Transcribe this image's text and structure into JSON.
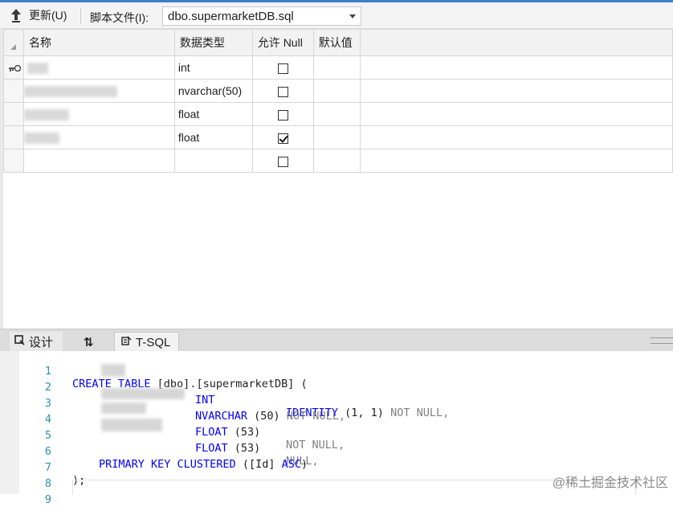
{
  "toolbar": {
    "update_label": "更新(U)",
    "script_file_label": "脚本文件(I):",
    "script_file_value": "dbo.supermarketDB.sql"
  },
  "grid": {
    "headers": [
      "名称",
      "数据类型",
      "允许 Null",
      "默认值"
    ],
    "rows": [
      {
        "type": "int",
        "allow_null": false,
        "primary_key": true
      },
      {
        "type": "nvarchar(50)",
        "allow_null": false,
        "primary_key": false
      },
      {
        "type": "float",
        "allow_null": false,
        "primary_key": false
      },
      {
        "type": "float",
        "allow_null": true,
        "primary_key": false
      },
      {
        "type": "",
        "allow_null": false,
        "primary_key": false
      }
    ]
  },
  "tabs": {
    "design": "设计",
    "swap": "⇅",
    "tsql": "T-SQL"
  },
  "code": {
    "line_numbers": [
      "1",
      "2",
      "3",
      "4",
      "5",
      "6",
      "7",
      "8",
      "9"
    ],
    "l1_kw": "CREATE TABLE",
    "l1_rest": " [dbo].[supermarketDB] (",
    "l2_type": "INT",
    "l2_identity": "IDENTITY",
    "l2_args": " (1, 1) ",
    "l2_null": "NOT NULL,",
    "l3_type": "NVARCHAR",
    "l3_args": " (50) ",
    "l3_null": "NOT NULL,",
    "l4_type": "FLOAT",
    "l4_args": " (53)",
    "l4_null": "NOT NULL,",
    "l5_type": "FLOAT",
    "l5_args": " (53)",
    "l5_null": "NULL,",
    "l6_kw": "PRIMARY KEY CLUSTERED",
    "l6_rest": " ([Id] ",
    "l6_asc": "ASC",
    "l6_close": ")",
    "l7": ");"
  },
  "watermark": "@稀土掘金技术社区"
}
